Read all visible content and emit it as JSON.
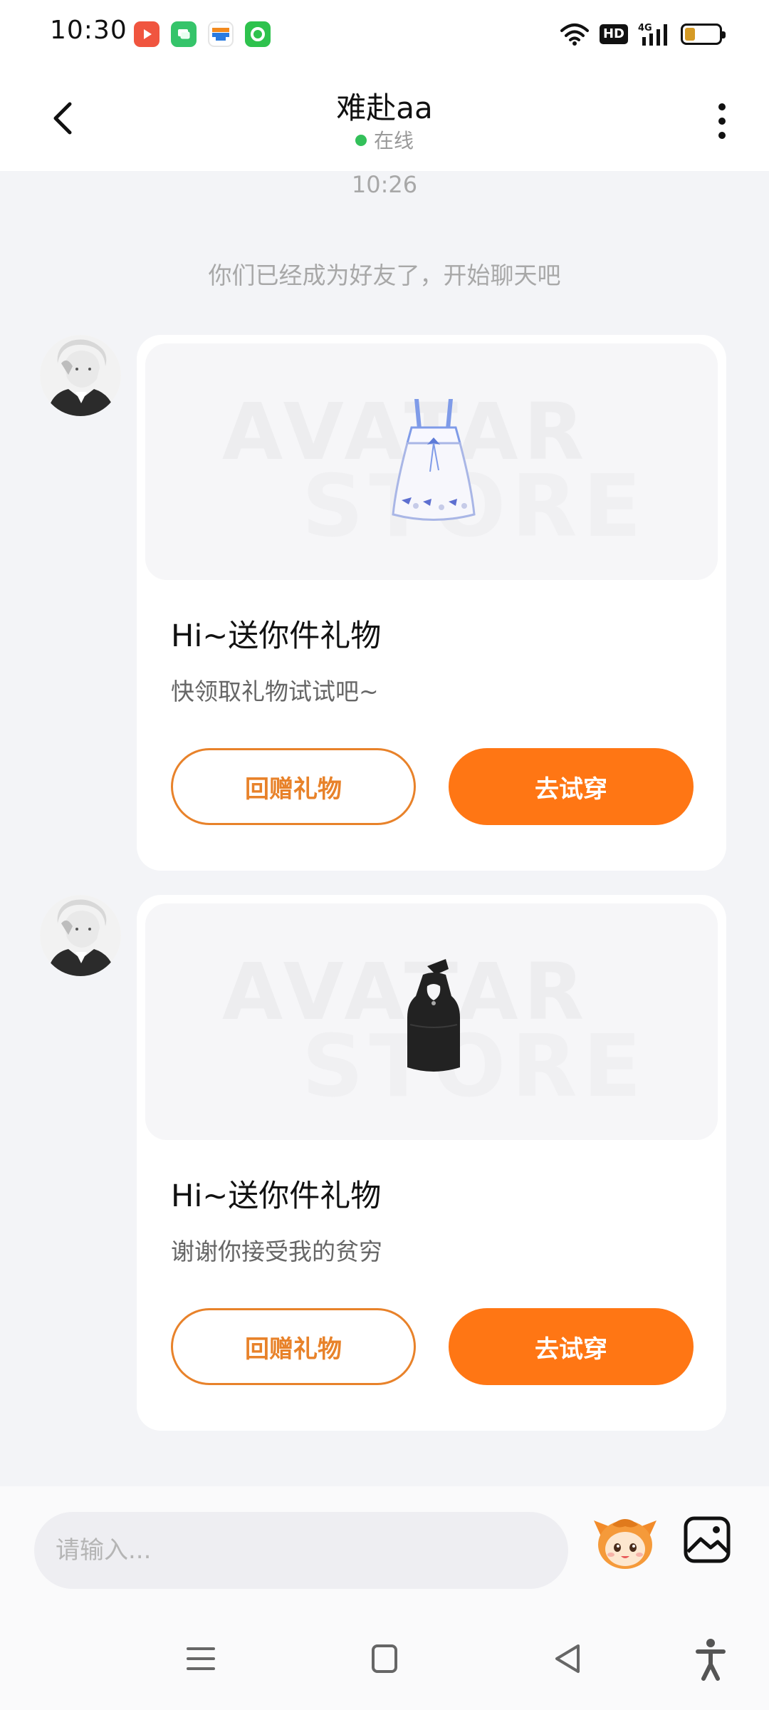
{
  "status_bar": {
    "time": "10:30",
    "app_icons": [
      "video-app-icon",
      "chat-app-icon",
      "bank-card-app-icon",
      "green-ring-app-icon"
    ],
    "hd_label": "HD",
    "network": "4G",
    "battery_level": 0.3
  },
  "header": {
    "title": "难赴aa",
    "status": "在线",
    "status_color": "#33c05a"
  },
  "chat": {
    "timestamp": "10:26",
    "system_message": "你们已经成为好友了，开始聊天吧",
    "cards": [
      {
        "watermark_line1": "AVATAR",
        "watermark_line2": "STORE",
        "gift_item": "white-dress-icon",
        "title": "Hi~送你件礼物",
        "subtitle": "快领取礼物试试吧~",
        "return_button": "回赠礼物",
        "try_button": "去试穿"
      },
      {
        "watermark_line1": "AVATAR",
        "watermark_line2": "STORE",
        "gift_item": "black-halter-top-icon",
        "title": "Hi~送你件礼物",
        "subtitle": "谢谢你接受我的贫穷",
        "return_button": "回赠礼物",
        "try_button": "去试穿"
      }
    ]
  },
  "input": {
    "placeholder": "请输入..."
  },
  "colors": {
    "accent": "#ff7614",
    "accent_outline": "#e8822a",
    "background": "#f3f4f7"
  }
}
